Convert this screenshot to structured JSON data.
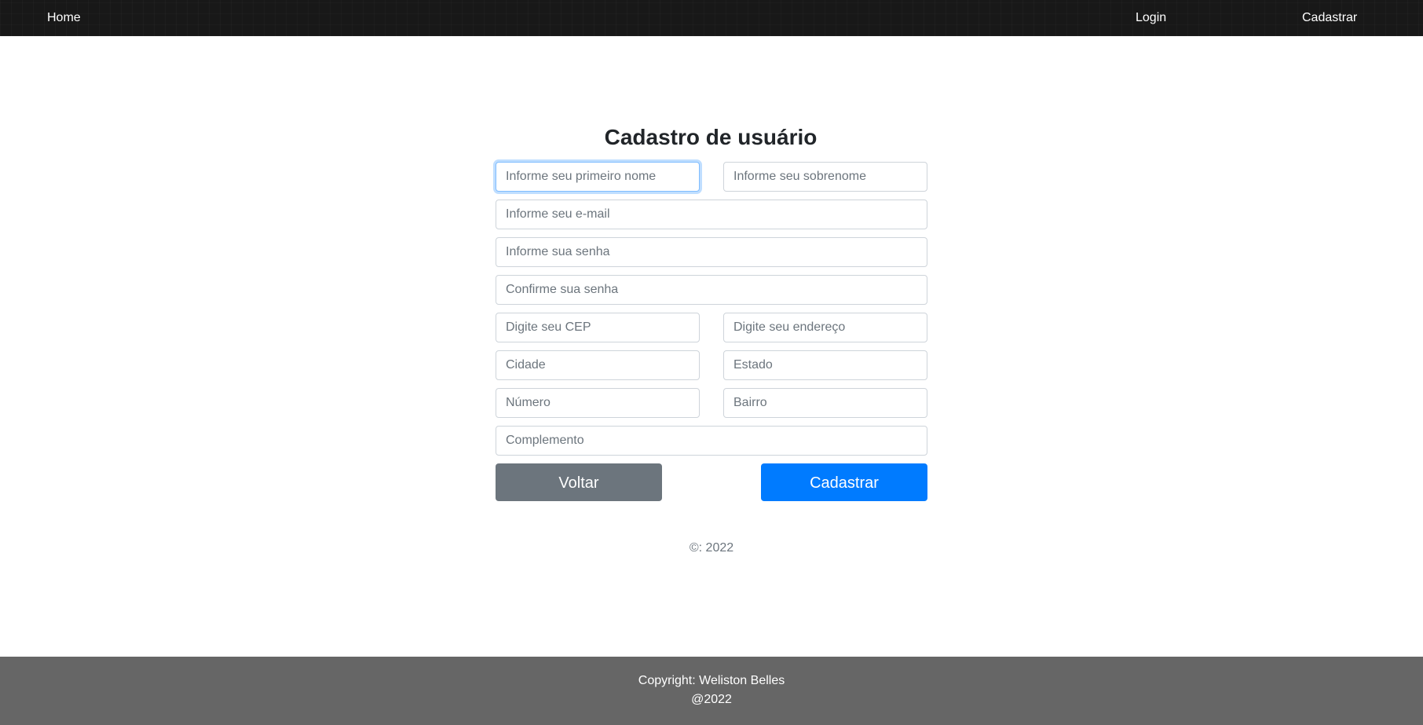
{
  "navbar": {
    "home": "Home",
    "login": "Login",
    "cadastrar": "Cadastrar"
  },
  "form": {
    "title": "Cadastro de usuário",
    "fields": {
      "primeiro_nome": {
        "placeholder": "Informe seu primeiro nome",
        "value": ""
      },
      "sobrenome": {
        "placeholder": "Informe seu sobrenome",
        "value": ""
      },
      "email": {
        "placeholder": "Informe seu e-mail",
        "value": ""
      },
      "senha": {
        "placeholder": "Informe sua senha",
        "value": ""
      },
      "confirme_senha": {
        "placeholder": "Confirme sua senha",
        "value": ""
      },
      "cep": {
        "placeholder": "Digite seu CEP",
        "value": ""
      },
      "endereco": {
        "placeholder": "Digite seu endereço",
        "value": ""
      },
      "cidade": {
        "placeholder": "Cidade",
        "value": ""
      },
      "estado": {
        "placeholder": "Estado",
        "value": ""
      },
      "numero": {
        "placeholder": "Número",
        "value": ""
      },
      "bairro": {
        "placeholder": "Bairro",
        "value": ""
      },
      "complemento": {
        "placeholder": "Complemento",
        "value": ""
      }
    },
    "buttons": {
      "voltar": "Voltar",
      "cadastrar": "Cadastrar"
    },
    "copyright": "©: 2022"
  },
  "footer": {
    "line1": "Copyright: Weliston Belles",
    "line2": "@2022"
  },
  "colors": {
    "navbar_bg": "#181818",
    "primary": "#007bff",
    "secondary": "#6c757d",
    "footer_bg": "#666666"
  }
}
